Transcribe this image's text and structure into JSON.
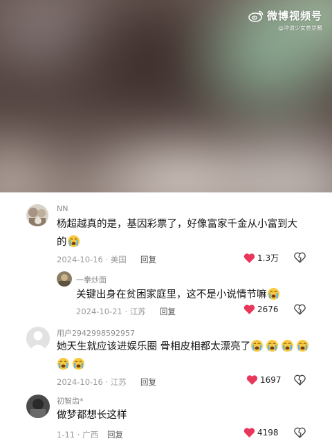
{
  "watermark": {
    "brand": "微博视频号",
    "handle": "@冲浪少女竟芽酱"
  },
  "colors": {
    "heart": "#e8375b",
    "meta_text": "#9a9a9a",
    "username_text": "#8a8a8a"
  },
  "comments": [
    {
      "username": "NN",
      "text_line1": "杨超越真的是，基因彩票了，好像富家千金从小富到大",
      "text_line2": "的",
      "emoji": "loudly-crying-face",
      "date": "2024-10-16",
      "location": "美国",
      "reply_label": "回复",
      "likes": "1.3万"
    },
    {
      "username": "一拳炒面",
      "text": "关键出身在贫困家庭里，这不是小说情节嘛",
      "emoji": "loudly-crying-face",
      "date": "2024-10-21",
      "location": "江苏",
      "reply_label": "回复",
      "likes": "2676"
    },
    {
      "username": "用户2942998592957",
      "text": "她天生就应该进娱乐圈  骨相皮相都太漂亮了",
      "emoji_count": 6,
      "date": "2024-10-16",
      "location": "江苏",
      "reply_label": "回复",
      "likes": "1697"
    },
    {
      "username": "初智齿*",
      "text": "做梦都想长这样",
      "date": "1-11",
      "location": "广西",
      "reply_label": "回复",
      "likes": "4198"
    }
  ]
}
